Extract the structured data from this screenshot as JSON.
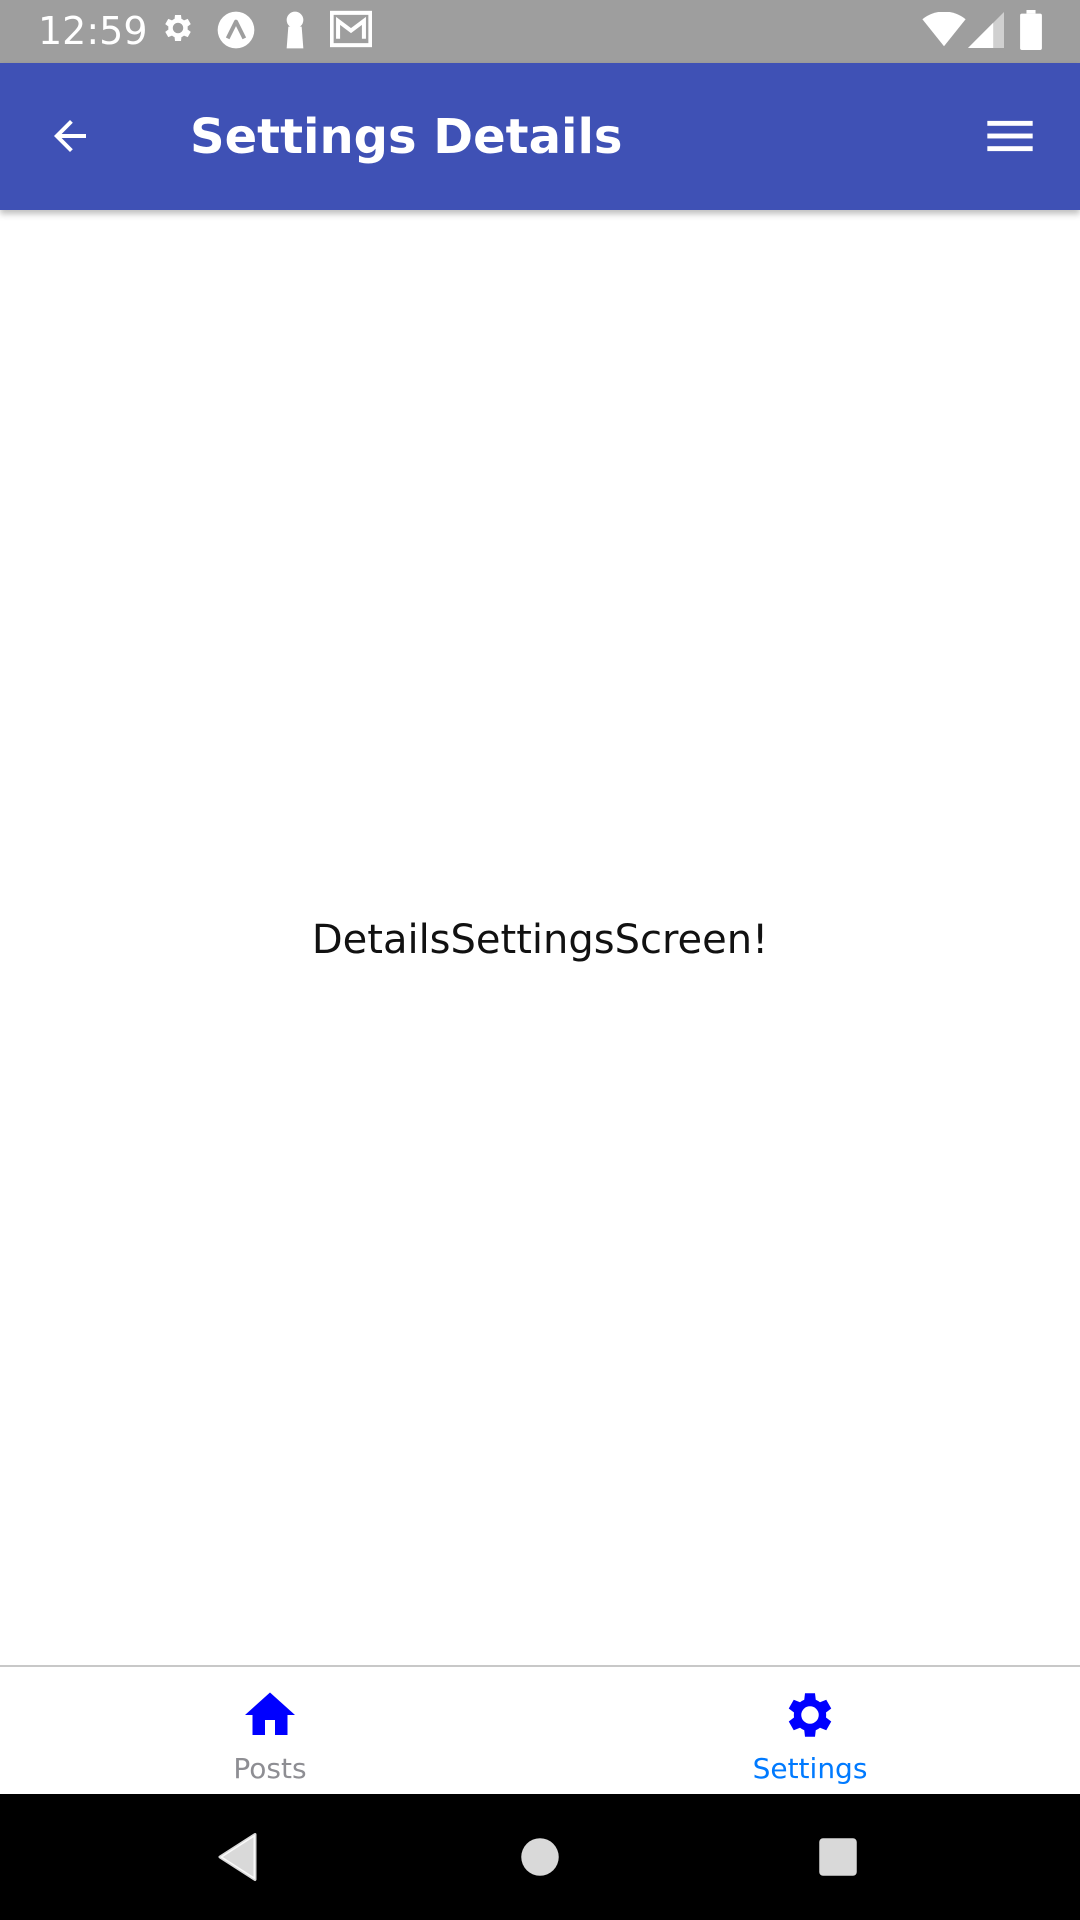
{
  "status_bar": {
    "time": "12:59",
    "left_icons": [
      "settings-gear-icon",
      "expo-icon",
      "keyhole-icon",
      "mail-icon"
    ],
    "right_icons": [
      "wifi-icon",
      "signal-icon",
      "battery-icon"
    ]
  },
  "app_bar": {
    "title": "Settings Details",
    "back_icon": "arrow-back-icon",
    "menu_icon": "hamburger-menu-icon",
    "color": "#3f51b5"
  },
  "content": {
    "message": "DetailsSettingsScreen!"
  },
  "tabs": [
    {
      "label": "Posts",
      "icon": "home-icon",
      "active": false,
      "label_color": "#8e8e93",
      "icon_color": "#0000ff"
    },
    {
      "label": "Settings",
      "icon": "gear-icon",
      "active": true,
      "label_color": "#007aff",
      "icon_color": "#0000ff"
    }
  ],
  "nav_bar": {
    "buttons": [
      "back-triangle-icon",
      "home-circle-icon",
      "recents-square-icon"
    ]
  }
}
